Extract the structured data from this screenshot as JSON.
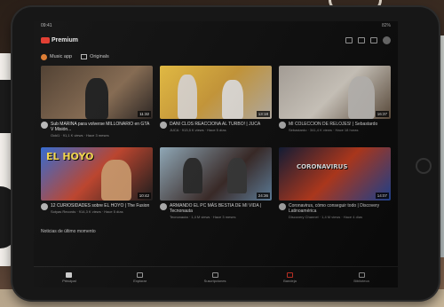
{
  "status": {
    "time": "09:41",
    "battery": "82%"
  },
  "header": {
    "brand": "Premium"
  },
  "chips": [
    {
      "label": "Music app"
    },
    {
      "label": "Originals"
    }
  ],
  "videos": [
    {
      "title": "Sub MARINA para volverse MILLONARIO en GTA V Misión...",
      "sub": "Ocki1 · 91,1 K views · Hace 3 meses",
      "duration": "11:32"
    },
    {
      "title": "DANI CLOS REACCIONA AL TURBO! | JUCA",
      "sub": "JUCA · 913,5 K views · Hace 5 días",
      "duration": "13:18"
    },
    {
      "title": "MI COLECCION DE RELOJES! | Sebastardo",
      "sub": "Sebastardo · 341,4 K views · Hace 18 horas",
      "duration": "16:37"
    },
    {
      "title": "12 CURIOSIDADES sobre EL HOYO | The Fusion",
      "sub": "Sotyas Records · 914,3 K views · Hace 5 días",
      "duration": "10:42",
      "overlay": "EL HOYO"
    },
    {
      "title": "ARMANDO EL PC MÁS BESTIA DE MI VIDA | Tecnonauta",
      "sub": "Tecnonauta · 1,4 M views · Hace 3 meses",
      "duration": "24:36"
    },
    {
      "title": "Coronavirus, cómo conseguir todo | Discovery Latinoamérica",
      "sub": "Discovery Channel · 1,4 M views · Hace 4 días",
      "duration": "14:07",
      "overlay": "CORONAVIRUS"
    }
  ],
  "section_title": "Noticias de último momento",
  "nav": [
    {
      "label": "Principal"
    },
    {
      "label": "Explorar"
    },
    {
      "label": "Suscripciones"
    },
    {
      "label": "Bandeja"
    },
    {
      "label": "Biblioteca"
    }
  ]
}
